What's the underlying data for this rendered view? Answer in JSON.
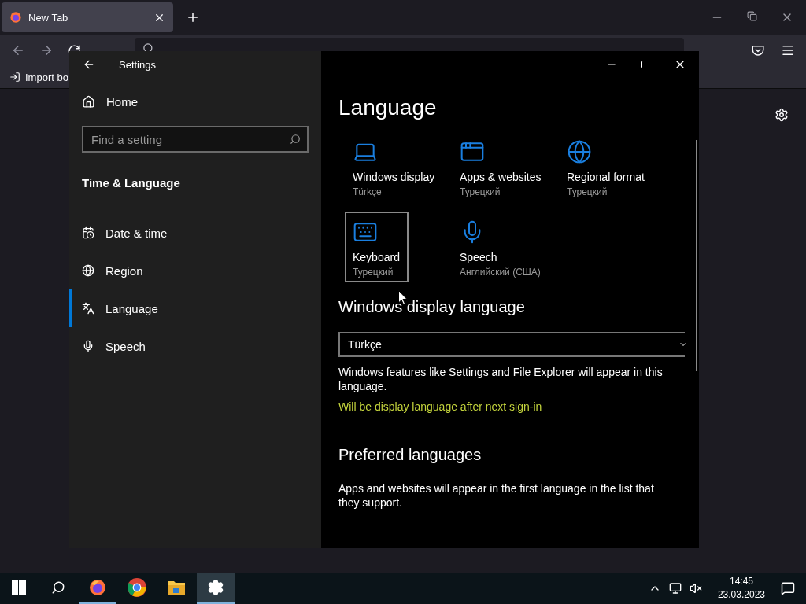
{
  "browser": {
    "tab": {
      "title": "New Tab"
    },
    "bookmark": "Import bo"
  },
  "settings": {
    "title": "Settings",
    "home": "Home",
    "search_placeholder": "Find a setting",
    "section": "Time & Language",
    "nav_items": [
      {
        "label": "Date & time",
        "selected": false
      },
      {
        "label": "Region",
        "selected": false
      },
      {
        "label": "Language",
        "selected": true
      },
      {
        "label": "Speech",
        "selected": false
      }
    ],
    "page_title": "Language",
    "tiles": [
      {
        "title": "Windows display",
        "subtitle": "Türkçe",
        "selected": false
      },
      {
        "title": "Apps & websites",
        "subtitle": "Турецкий",
        "selected": false
      },
      {
        "title": "Regional format",
        "subtitle": "Турецкий",
        "selected": false
      },
      {
        "title": "Keyboard",
        "subtitle": "Турецкий",
        "selected": true
      },
      {
        "title": "Speech",
        "subtitle": "Английский (США)",
        "selected": false
      }
    ],
    "display_language": {
      "heading": "Windows display language",
      "value": "Türkçe",
      "description": "Windows features like Settings and File Explorer will appear in this language.",
      "notice": "Will be display language after next sign-in"
    },
    "preferred": {
      "heading": "Preferred languages",
      "description": "Apps and websites will appear in the first language in the list that they support."
    }
  },
  "taskbar": {
    "apps": [
      {
        "running": true,
        "selected": false
      },
      {
        "running": false,
        "selected": false
      },
      {
        "running": false,
        "selected": false
      },
      {
        "running": true,
        "selected": true
      }
    ],
    "time": "14:45",
    "date": "23.03.2023"
  }
}
